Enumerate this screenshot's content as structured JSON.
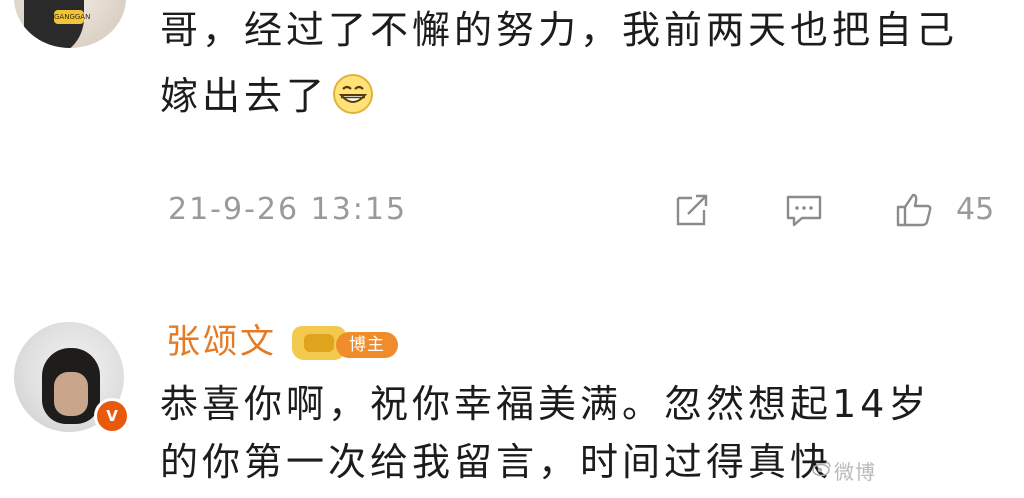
{
  "comment_1": {
    "text_line_1": "哥，经过了不懈的努力，我前两天也把自己",
    "text_line_2": "嫁出去了",
    "emoji": "grinning-face-emoji",
    "timestamp": "21-9-26 13:15",
    "like_count": "45",
    "avatar_tag": "GANGGAN"
  },
  "comment_2": {
    "username": "张颂文",
    "badge_label": "博主",
    "verified_badge": "V",
    "text_line_1": "恭喜你啊，祝你幸福美满。忽然想起14岁",
    "text_line_2": "的你第一次给我留言，时间过得真快"
  },
  "watermark": "微博",
  "colors": {
    "username": "#e57a22",
    "meta": "#9a9a9a",
    "badge": "#f08c2c",
    "verified": "#e8590c"
  },
  "icons": [
    "share-icon",
    "comment-icon",
    "like-icon"
  ]
}
